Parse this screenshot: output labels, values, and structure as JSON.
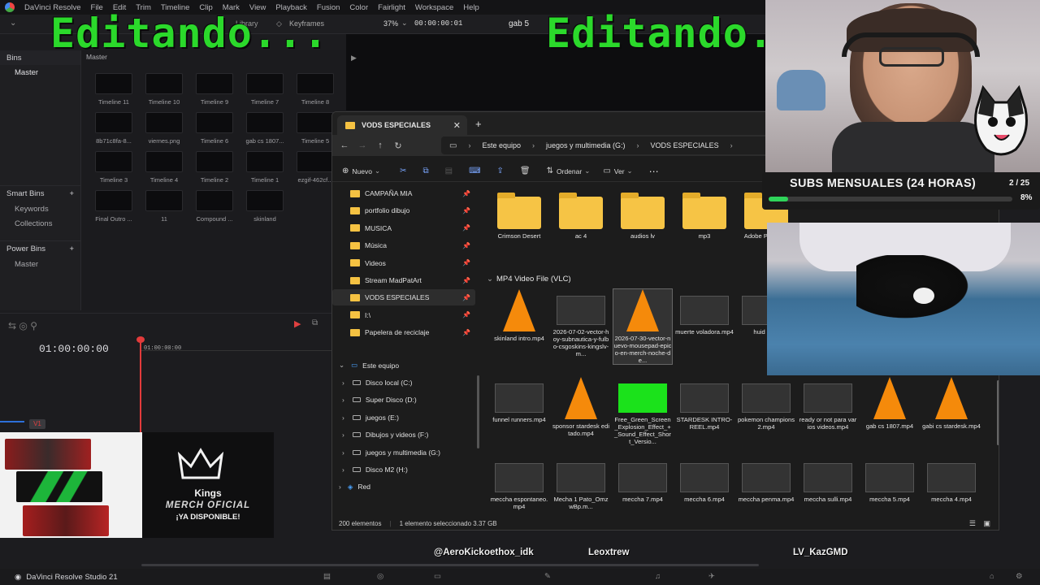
{
  "app": {
    "name": "DaVinci Resolve",
    "menu": [
      "File",
      "Edit",
      "Trim",
      "Timeline",
      "Clip",
      "Mark",
      "View",
      "Playback",
      "Fusion",
      "Color",
      "Fairlight",
      "Workspace",
      "Help"
    ],
    "project_title": "gab 5",
    "zoom": "37%",
    "viewer_tc": "00:00:00:01",
    "keyframes_label": "Keyframes",
    "library_label": "Library",
    "footer_label": "DaVinci Resolve Studio 21"
  },
  "overlay": {
    "editing_left": "Editando...",
    "editing_right": "Editando."
  },
  "bins": {
    "header": "Bins",
    "master": "Master",
    "smart_bins": "Smart Bins",
    "smart_items": [
      "Keywords",
      "Collections"
    ],
    "power_bins": "Power Bins",
    "power_items": [
      "Master"
    ]
  },
  "media_pool": {
    "header": "Master",
    "clips": [
      "Timeline 11",
      "Timeline 10",
      "Timeline 9",
      "Timeline 7",
      "Timeline 8",
      "8b71c8fa-8...",
      "viernes.png",
      "Timeline 6",
      "gab cs 1807...",
      "Timeline 5",
      "Timeline 3",
      "Timeline 4",
      "Timeline 2",
      "Timeline 1",
      "ezgif-462cf...",
      "Final Outro ...",
      "11",
      "Compound ...",
      "skinland"
    ]
  },
  "timeline": {
    "timecode": "01:00:00:00",
    "ruler_tc": "01:00:00:00",
    "track": "V1"
  },
  "merch": {
    "brand": "Kings",
    "line1": "MERCH OFICIAL",
    "line2": "¡YA DISPONIBLE!"
  },
  "explorer": {
    "tab_title": "VODS ESPECIALES",
    "breadcrumbs": [
      "Este equipo",
      "juegos y multimedia (G:)",
      "VODS ESPECIALES"
    ],
    "commands": {
      "new": "Nuevo",
      "sort": "Ordenar",
      "view": "Ver"
    },
    "quick_access": [
      "CAMPAÑA MIA",
      "portfolio dibujo",
      "MUSICA",
      "Música",
      "Videos",
      "Stream MadPatArt",
      "VODS ESPECIALES",
      "I:\\",
      "Papelera de reciclaje"
    ],
    "this_pc": "Este equipo",
    "drives": [
      "Disco local (C:)",
      "Super Disco (D:)",
      "juegos (E:)",
      "Dibujos y videos (F:)",
      "juegos y multimedia (G:)",
      "Disco M2 (H:)"
    ],
    "network": "Red",
    "folders": [
      "Crimson Desert",
      "ac 4",
      "audios lv",
      "mp3",
      "Adobe Pro C Au"
    ],
    "group_header": "MP4 Video File (VLC)",
    "videos_row1": [
      "skinland intro.mp4",
      "2026-07-02-vector-hoy-subnautica-y-fulbo-csgoskins-kingslv-m...",
      "2026-07-30-vector-nuevo-mousepad-epico-en-merch-noche-de...",
      "muerte voladora.mp4",
      "huid cero"
    ],
    "videos_row2": [
      "funnel runners.mp4",
      "sponsor stardesk editado.mp4",
      "Free_Green_Screen_Explosion_Effect_+_Sound_Effect_Short_Versio...",
      "STARDESK INTRO-REEL.mp4",
      "pokemon champions 2.mp4",
      "ready or not para varios videos.mp4",
      "gab cs 1807.mp4",
      "gabi cs stardesk.mp4"
    ],
    "videos_row3": [
      "meccha espontaneo.mp4",
      "Mecha 1 Pato_OmzwBp.m...",
      "meccha 7.mp4",
      "meccha 6.mp4",
      "meccha penma.mp4",
      "meccha sulli.mp4",
      "meccha 5.mp4",
      "meccha 4.mp4"
    ],
    "status_count": "200 elementos",
    "status_selected": "1 elemento seleccionado  3.37 GB"
  },
  "subs_widget": {
    "title": "SUBS MENSUALES (24 HORAS)",
    "count": "2 / 25",
    "percent": "8%",
    "progress": 0.08,
    "colors": {
      "bar": "#2fd45a"
    }
  },
  "name_tags": [
    "@AeroKick",
    "oethox_idk",
    "Leoxtrew",
    "LV_KazGMD"
  ],
  "colors": {
    "overlay_green": "#2bd92b",
    "folder": "#f6c445",
    "vlc": "#f58a0b"
  }
}
